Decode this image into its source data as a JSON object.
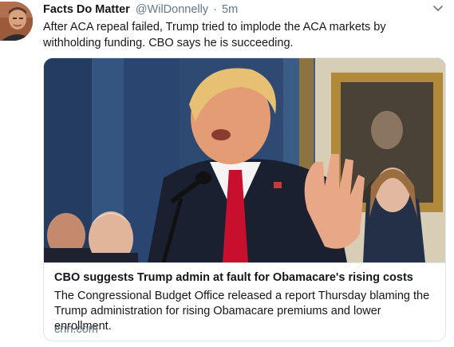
{
  "tweet": {
    "display_name": "Facts Do Matter",
    "handle": "@WilDonnelly",
    "separator": "·",
    "timestamp": "5m",
    "text": "After ACA repeal failed, Trump tried to implode the ACA markets by withholding funding. CBO says he is succeeding.",
    "avatar_icon": "profile-photo",
    "caret_icon": "chevron-down-icon"
  },
  "card": {
    "image_icon": "news-photo",
    "title": "CBO suggests Trump admin at fault for Obamacare's rising costs",
    "description": "The Congressional Budget Office released a report Thursday blaming the Trump administration for rising Obamacare premiums and lower enrollment.",
    "domain": "cnn.com"
  },
  "colors": {
    "text": "#14171a",
    "secondary": "#657786",
    "border": "#e1e8ed"
  }
}
